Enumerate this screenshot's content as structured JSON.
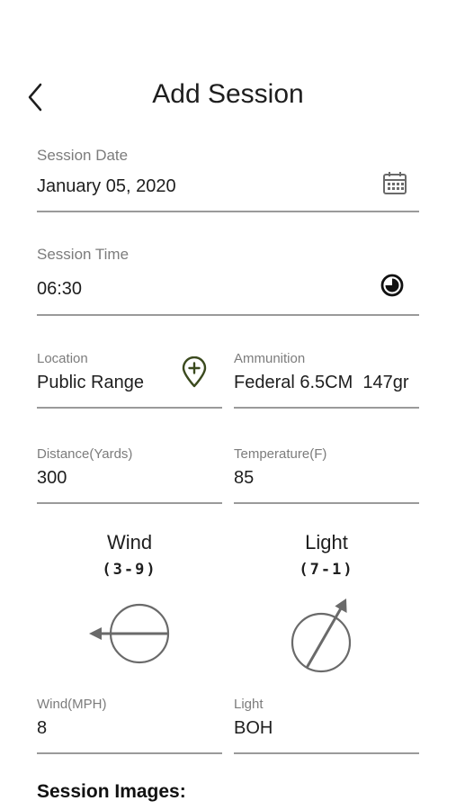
{
  "header": {
    "title": "Add Session"
  },
  "session_date": {
    "label": "Session Date",
    "value": "January 05, 2020"
  },
  "session_time": {
    "label": "Session Time",
    "value": "06:30"
  },
  "location": {
    "label": "Location",
    "value": "Public Range"
  },
  "ammunition": {
    "label": "Ammunition",
    "value": "Federal 6.5CM  147gr"
  },
  "distance": {
    "label": "Distance(Yards)",
    "value": "300"
  },
  "temperature": {
    "label": "Temperature(F)",
    "value": "85"
  },
  "wind_direction": {
    "title": "Wind",
    "range": "(3-9)"
  },
  "light_direction": {
    "title": "Light",
    "range": "(7-1)"
  },
  "wind_speed": {
    "label": "Wind(MPH)",
    "value": "8"
  },
  "light": {
    "label": "Light",
    "value": "BOH"
  },
  "session_images": {
    "title": "Session Images:"
  },
  "colors": {
    "accent": "#3b4a1e",
    "text": "#1e1e1e",
    "label": "#7c7c7c",
    "divider": "#9a9a9a"
  }
}
